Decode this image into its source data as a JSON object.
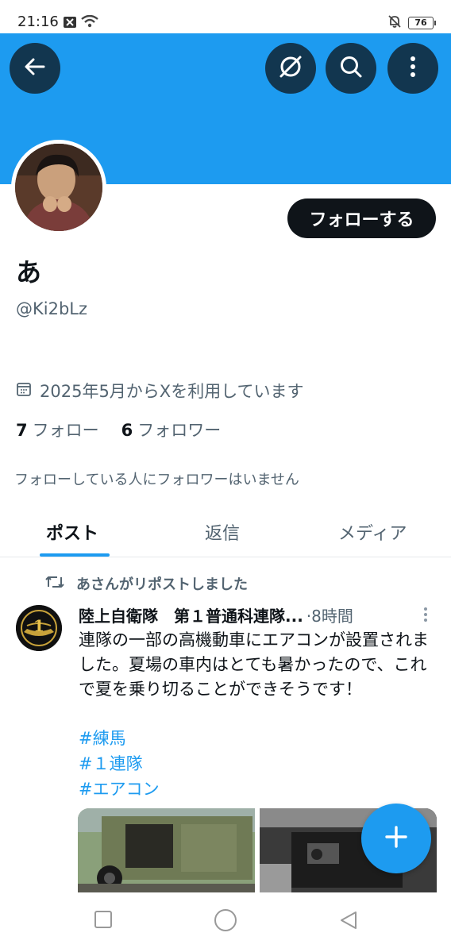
{
  "status_bar": {
    "time": "21:16",
    "battery": "76",
    "icons": [
      "sim-x-icon",
      "wifi-icon",
      "bell-off-icon",
      "battery-icon"
    ]
  },
  "header": {
    "back_icon": "arrow-left-icon",
    "grok_icon": "grok-icon",
    "search_icon": "search-icon",
    "more_icon": "more-vertical-icon",
    "banner_color": "#1d9bf0"
  },
  "profile": {
    "display_name": "あ",
    "handle": "@Ki2bLz",
    "follow_label": "フォローする",
    "joined": "2025年5月からXを利用しています",
    "following_count": "7",
    "following_label": "フォロー",
    "followers_count": "6",
    "followers_label": "フォロワー",
    "no_mutual": "フォローしている人にフォロワーはいません"
  },
  "tabs": [
    {
      "label": "ポスト",
      "active": true
    },
    {
      "label": "返信",
      "active": false
    },
    {
      "label": "メディア",
      "active": false
    }
  ],
  "post": {
    "repost_text": "あさんがリポストしました",
    "author": "陸上自衛隊　第１普通科連隊...",
    "time": "·8時間",
    "text": "連隊の一部の高機動車にエアコンが設置されました。夏場の車内はとても暑かったので、これで夏を乗り切ることができそうです！",
    "hashtags": [
      "#練馬",
      "#１連隊",
      "#エアコン"
    ],
    "avatar_emblem": "1"
  },
  "fab": {
    "icon": "plus-icon"
  },
  "nav": {
    "icons": [
      "recents-square-icon",
      "home-circle-icon",
      "back-triangle-icon"
    ]
  },
  "colors": {
    "accent": "#1d9bf0",
    "text": "#0f1419",
    "secondary": "#536471"
  }
}
